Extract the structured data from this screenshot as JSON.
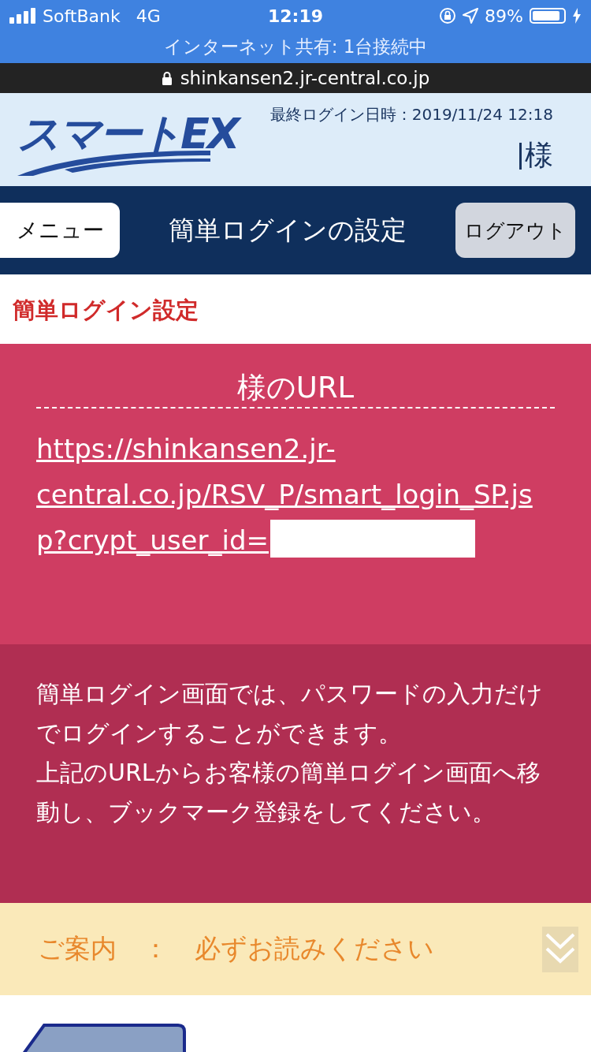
{
  "status_bar": {
    "carrier": "SoftBank",
    "network": "4G",
    "time": "12:19",
    "battery": "89%",
    "tethering": "インターネット共有: 1台接続中"
  },
  "address_bar": {
    "url": "shinkansen2.jr-central.co.jp"
  },
  "header": {
    "logo": "スマートEX",
    "last_login": "最終ログイン日時：2019/11/24 12:18",
    "user_suffix": "様"
  },
  "nav": {
    "menu_button": "メニュー",
    "title": "簡単ログインの設定",
    "logout_button": "ログアウト"
  },
  "section_title": "簡単ログイン設定",
  "url_box": {
    "heading": "様のURL",
    "link": "https://shinkansen2.jr-central.co.jp/RSV_P/smart_login_SP.jsp?crypt_user_id="
  },
  "description": [
    "簡単ログイン画面では、パスワードの入力だけでログインすることができます。",
    "上記のURLからお客様の簡単ログイン画面へ移動し、ブックマーク登録をしてください。"
  ],
  "notice": {
    "label": "ご案内　：　必ずお読みください",
    "expanded": false
  }
}
